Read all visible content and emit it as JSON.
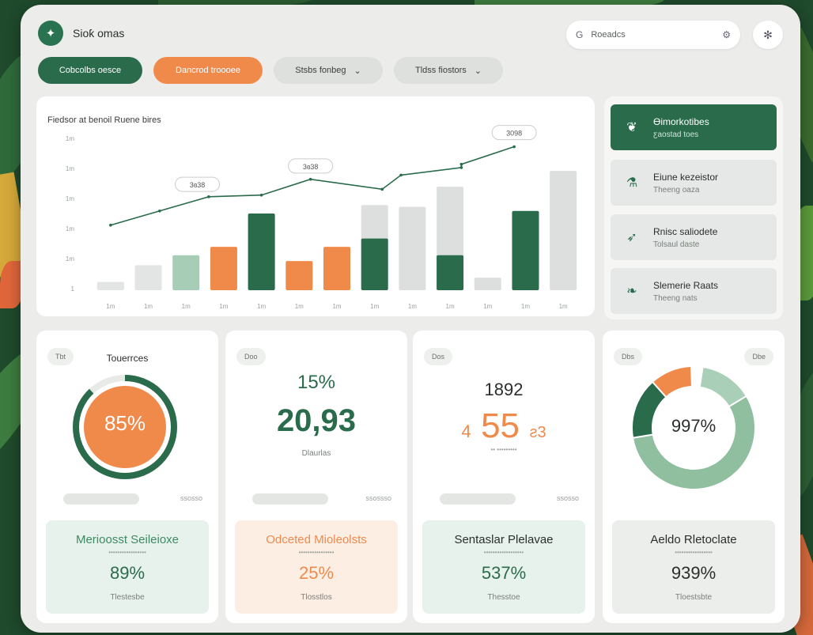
{
  "app": {
    "title": "Sioƙ omas"
  },
  "search": {
    "placeholder": "Roeadcs"
  },
  "filters": [
    {
      "label": "Cobcolbs oesce",
      "style": "green"
    },
    {
      "label": "Dancrod troooee",
      "style": "orange"
    },
    {
      "label": "Stsbs fonbeg",
      "style": "gray",
      "chevron": "chevron-down-icon"
    },
    {
      "label": "Tldss fiostors",
      "style": "gray",
      "chevron": "chevron-down-icon"
    }
  ],
  "chart_data": {
    "type": "bar",
    "title": "Fiedsor at benoil Ruene bires",
    "yticks": [
      "1m",
      "1m",
      "1m",
      "1m",
      "1m",
      "1"
    ],
    "xticks": [
      "1m",
      "1m",
      "1m",
      "1m",
      "1m",
      "1m",
      "1m",
      "1m",
      "1m",
      "1m",
      "1m",
      "1m",
      "1m"
    ],
    "bars": [
      {
        "value": 1.0,
        "color": "#e2e5e3"
      },
      {
        "value": 3.0,
        "color": "#e2e5e3"
      },
      {
        "value": 4.2,
        "color": "#a7cdb6"
      },
      {
        "value": 5.2,
        "color": "#f08a4b"
      },
      {
        "value": 9.2,
        "color": "#2a6b4c"
      },
      {
        "value": 3.5,
        "color": "#f08a4b"
      },
      {
        "value": 5.2,
        "color": "#f08a4b"
      },
      {
        "value": 10.2,
        "color": "#dcdfdd",
        "overlay": {
          "value": 6.2,
          "color": "#2a6b4c"
        }
      },
      {
        "value": 10.0,
        "color": "#dcdfdd"
      },
      {
        "value": 12.4,
        "color": "#dcdfdd",
        "overlay": {
          "value": 4.2,
          "color": "#2a6b4c"
        }
      },
      {
        "value": 1.5,
        "color": "#dcdfdd"
      },
      {
        "value": 9.5,
        "color": "#2a6b4c"
      },
      {
        "value": 14.3,
        "color": "#dcdfdd"
      }
    ],
    "line": {
      "color": "#2a6b4c",
      "points": [
        {
          "x": 0,
          "y": 7.8
        },
        {
          "x": 1.3,
          "y": 9.5
        },
        {
          "x": 2.6,
          "y": 11.2
        },
        {
          "x": 4.0,
          "y": 11.4
        },
        {
          "x": 5.3,
          "y": 13.3
        },
        {
          "x": 7.2,
          "y": 12.1
        },
        {
          "x": 7.7,
          "y": 13.8
        },
        {
          "x": 9.3,
          "y": 14.7
        },
        {
          "x": 9.3,
          "y": 15.1
        },
        {
          "x": 10.7,
          "y": 17.2
        }
      ]
    },
    "callouts": [
      {
        "label": "3ɞ38",
        "x": 2.3,
        "y": 12.6
      },
      {
        "label": "3ɞ38",
        "x": 5.3,
        "y": 14.8
      },
      {
        "label": "3098",
        "x": 10.7,
        "y": 18.8
      }
    ],
    "ylim": [
      0,
      20
    ]
  },
  "side_items": [
    {
      "title": "Ɵimorkotibes",
      "sub": "ƹaostad toes",
      "icon": "leaf-icon",
      "active": true
    },
    {
      "title": "Eiune kezeistor",
      "sub": "Theeng oaza",
      "icon": "flask-icon",
      "active": false
    },
    {
      "title": "Rnisc saliodete",
      "sub": "Tolsaul daste",
      "icon": "feather-icon",
      "active": false
    },
    {
      "title": "Slemerie Raats",
      "sub": "Theeng nats",
      "icon": "bird-icon",
      "active": false
    }
  ],
  "kpis": [
    {
      "tag": "Tbt",
      "head": "Touerrces",
      "ring_value": "85%",
      "ring_fraction": 0.88,
      "bar_note": "ssosso",
      "sub": {
        "title": "Merioosst Seileioxe",
        "small": "•••••••••••••••••",
        "value": "89%",
        "foot": "Tlestesbe",
        "theme": "green"
      }
    },
    {
      "tag": "Doo",
      "top": "15%",
      "big": "20,93",
      "caption": "Dlaurlas",
      "bar_note": "ssossso",
      "sub": {
        "title": "Odceted Mioleolsts",
        "small": "••••••••••••••••",
        "value": "25%",
        "foot": "Tlosstlos",
        "theme": "orange"
      }
    },
    {
      "tag": "Dos",
      "top": "1892",
      "big_left": "4",
      "big": "55",
      "big_right": "ƨ3",
      "caption": "•• •••••••••",
      "bar_note": "ssosso",
      "sub": {
        "title": "Sentaslar Plelavae",
        "small": "••••••••••••••••••",
        "value": "537%",
        "foot": "Thesstoe",
        "theme": "green"
      }
    },
    {
      "tag": "Dbs",
      "tag2": "Dbe",
      "donut_value": "997%",
      "donut": [
        {
          "value": 0.14,
          "color": "#a9cfb8"
        },
        {
          "value": 0.56,
          "color": "#8fbf9f"
        },
        {
          "value": 0.16,
          "color": "#2a6b4c"
        },
        {
          "value": 0.11,
          "color": "#f08a4b"
        }
      ],
      "sub": {
        "title": "Aeldo Rletoclate",
        "small": "•••••••••••••••••",
        "value": "939%",
        "foot": "Tloestsbte",
        "theme": "gray"
      }
    }
  ]
}
